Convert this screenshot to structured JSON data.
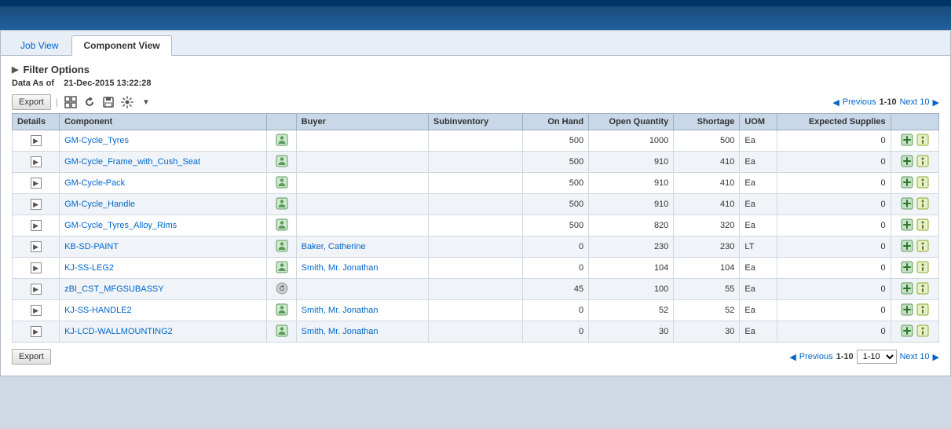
{
  "header": {
    "bg_color": "#1a4a7a"
  },
  "tabs": [
    {
      "id": "job-view",
      "label": "Job View",
      "active": false
    },
    {
      "id": "component-view",
      "label": "Component View",
      "active": true
    }
  ],
  "filter": {
    "title": "Filter Options",
    "data_as_of_label": "Data As of",
    "data_as_of_value": "21-Dec-2015 13:22:28"
  },
  "toolbar": {
    "export_label": "Export",
    "separator": "|"
  },
  "pagination": {
    "previous_label": "Previous",
    "next_label": "Next 10",
    "range": "1-10"
  },
  "table": {
    "columns": [
      {
        "id": "details",
        "label": "Details"
      },
      {
        "id": "component",
        "label": "Component"
      },
      {
        "id": "buyer_icon",
        "label": ""
      },
      {
        "id": "buyer",
        "label": "Buyer"
      },
      {
        "id": "subinventory",
        "label": "Subinventory"
      },
      {
        "id": "on_hand",
        "label": "On Hand"
      },
      {
        "id": "open_qty",
        "label": "Open Quantity"
      },
      {
        "id": "shortage",
        "label": "Shortage"
      },
      {
        "id": "uom",
        "label": "UOM"
      },
      {
        "id": "expected_supplies",
        "label": "Expected Supplies"
      },
      {
        "id": "actions",
        "label": ""
      }
    ],
    "rows": [
      {
        "component": "GM-Cycle_Tyres",
        "buyer": "",
        "subinventory": "",
        "on_hand": "500",
        "open_qty": "1000",
        "shortage": "500",
        "uom": "Ea",
        "expected": "0",
        "has_buyer_icon": true,
        "buyer_icon_type": "green"
      },
      {
        "component": "GM-Cycle_Frame_with_Cush_Seat",
        "buyer": "",
        "subinventory": "",
        "on_hand": "500",
        "open_qty": "910",
        "shortage": "410",
        "uom": "Ea",
        "expected": "0",
        "has_buyer_icon": true,
        "buyer_icon_type": "green"
      },
      {
        "component": "GM-Cycle-Pack",
        "buyer": "",
        "subinventory": "",
        "on_hand": "500",
        "open_qty": "910",
        "shortage": "410",
        "uom": "Ea",
        "expected": "0",
        "has_buyer_icon": true,
        "buyer_icon_type": "green"
      },
      {
        "component": "GM-Cycle_Handle",
        "buyer": "",
        "subinventory": "",
        "on_hand": "500",
        "open_qty": "910",
        "shortage": "410",
        "uom": "Ea",
        "expected": "0",
        "has_buyer_icon": true,
        "buyer_icon_type": "green"
      },
      {
        "component": "GM-Cycle_Tyres_Alloy_Rims",
        "buyer": "",
        "subinventory": "",
        "on_hand": "500",
        "open_qty": "820",
        "shortage": "320",
        "uom": "Ea",
        "expected": "0",
        "has_buyer_icon": true,
        "buyer_icon_type": "green"
      },
      {
        "component": "KB-SD-PAINT",
        "buyer": "Baker, Catherine",
        "subinventory": "",
        "on_hand": "0",
        "open_qty": "230",
        "shortage": "230",
        "uom": "LT",
        "expected": "0",
        "has_buyer_icon": true,
        "buyer_icon_type": "green"
      },
      {
        "component": "KJ-SS-LEG2",
        "buyer": "Smith, Mr. Jonathan",
        "subinventory": "",
        "on_hand": "0",
        "open_qty": "104",
        "shortage": "104",
        "uom": "Ea",
        "expected": "0",
        "has_buyer_icon": true,
        "buyer_icon_type": "green"
      },
      {
        "component": "zBI_CST_MFGSUBASSY",
        "buyer": "",
        "subinventory": "",
        "on_hand": "45",
        "open_qty": "100",
        "shortage": "55",
        "uom": "Ea",
        "expected": "0",
        "has_buyer_icon": true,
        "buyer_icon_type": "grey"
      },
      {
        "component": "KJ-SS-HANDLE2",
        "buyer": "Smith, Mr. Jonathan",
        "subinventory": "",
        "on_hand": "0",
        "open_qty": "52",
        "shortage": "52",
        "uom": "Ea",
        "expected": "0",
        "has_buyer_icon": true,
        "buyer_icon_type": "green"
      },
      {
        "component": "KJ-LCD-WALLMOUNTING2",
        "buyer": "Smith, Mr. Jonathan",
        "subinventory": "",
        "on_hand": "0",
        "open_qty": "30",
        "shortage": "30",
        "uom": "Ea",
        "expected": "0",
        "has_buyer_icon": true,
        "buyer_icon_type": "green"
      }
    ]
  },
  "footer": {
    "export_label": "Export",
    "previous_label": "Previous",
    "next_label": "Next 10",
    "range": "1-10"
  }
}
